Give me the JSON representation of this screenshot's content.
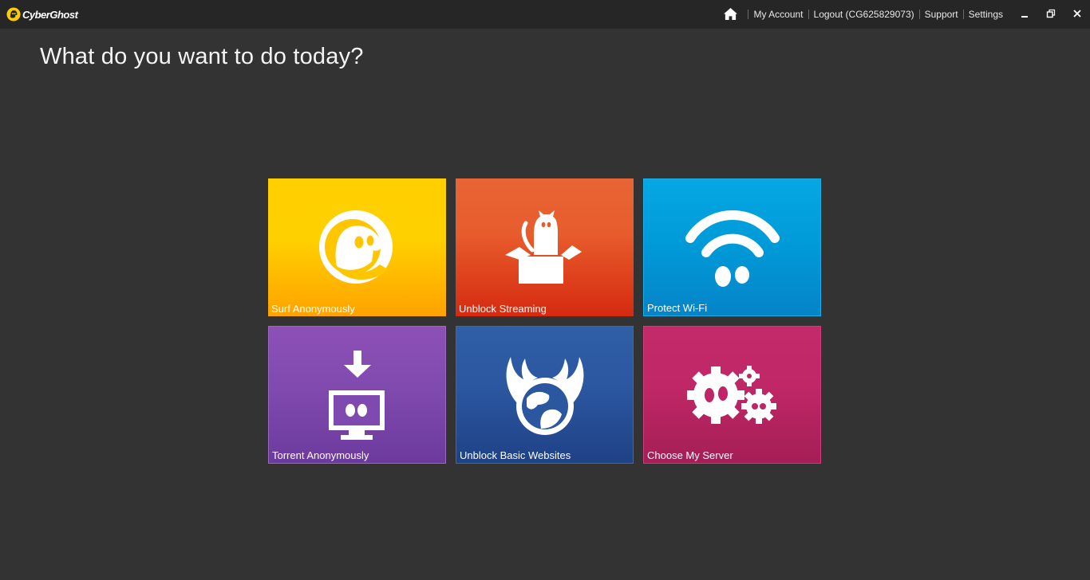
{
  "app": {
    "brand": "CyberGhost"
  },
  "nav": {
    "my_account": "My Account",
    "logout": "Logout (CG625829073)",
    "support": "Support",
    "settings": "Settings"
  },
  "main": {
    "title": "What do you want to do today?",
    "tiles": [
      {
        "label": "Surf Anonymously",
        "icon": "ghost-icon",
        "color": "#ffc200"
      },
      {
        "label": "Unblock Streaming",
        "icon": "cat-in-box-icon",
        "color": "#e0461e"
      },
      {
        "label": "Protect Wi-Fi",
        "icon": "wifi-icon",
        "color": "#0096d6"
      },
      {
        "label": "Torrent Anonymously",
        "icon": "download-monitor-icon",
        "color": "#7b45ab"
      },
      {
        "label": "Unblock Basic Websites",
        "icon": "winged-globe-icon",
        "color": "#2a529c"
      },
      {
        "label": "Choose My Server",
        "icon": "gears-icon",
        "color": "#b92462"
      }
    ]
  }
}
